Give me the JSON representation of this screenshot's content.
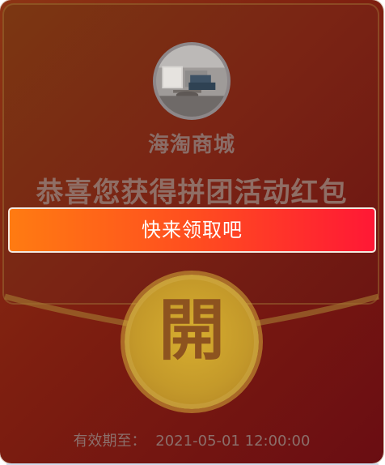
{
  "shop": {
    "name": "海淘商城",
    "avatar_icon": "living-room-photo-icon"
  },
  "message": {
    "congrats": "恭喜您获得拼团活动红包",
    "claim": "快来领取吧"
  },
  "actions": {
    "open_label": "開"
  },
  "expiry": {
    "label": "有效期至：",
    "datetime": "2021-05-01 12:00:00"
  },
  "colors": {
    "envelope_top": "#8d3414",
    "envelope_bottom": "#6a0d12",
    "claim_start": "#ff7b12",
    "claim_end": "#ff1835",
    "open_button": "#c4992a",
    "text_muted": "#8a6d67"
  }
}
